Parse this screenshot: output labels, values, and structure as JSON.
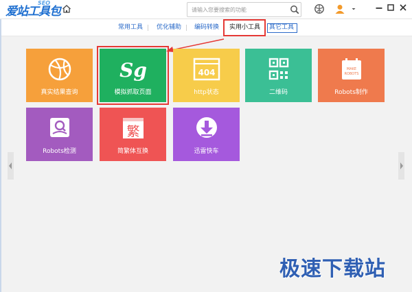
{
  "app": {
    "logo_text": "爱站工具包",
    "logo_sup": "SEO"
  },
  "search": {
    "placeholder": "请输入您要搜索的功能"
  },
  "tabs": [
    {
      "label": "常用工具"
    },
    {
      "label": "优化辅助"
    },
    {
      "label": "编码转换"
    },
    {
      "label": "实用小工具"
    },
    {
      "label": "其它工具"
    }
  ],
  "tiles": [
    {
      "label": "真实结果查询",
      "icon": "basketball-icon",
      "color": "#f6a03b"
    },
    {
      "label": "模拟抓取页面",
      "icon": "sg-spider-icon",
      "color": "#1fb05f"
    },
    {
      "label": "http状态",
      "icon": "404-icon",
      "color": "#f7cc4a"
    },
    {
      "label": "二维码",
      "icon": "qrcode-icon",
      "color": "#3bbf95"
    },
    {
      "label": "Robots制作",
      "icon": "robots-calendar-icon",
      "color": "#ef7a4d"
    },
    {
      "label": "Robots检测",
      "icon": "robots-inspect-icon",
      "color": "#a35bbf"
    },
    {
      "label": "简繁体互换",
      "icon": "fan-character-icon",
      "color": "#ef5454"
    },
    {
      "label": "迅雷快车",
      "icon": "download-icon",
      "color": "#a559dd"
    }
  ],
  "tile_icons": {
    "sg_text": "Sg",
    "http_text": "404",
    "fan_text": "繁",
    "make_robots_line1": "MAKE",
    "make_robots_line2": "ROBOTS"
  },
  "watermark": "极速下载站",
  "colors": {
    "accent_blue": "#2a6ac8",
    "highlight_red": "#e53935"
  }
}
